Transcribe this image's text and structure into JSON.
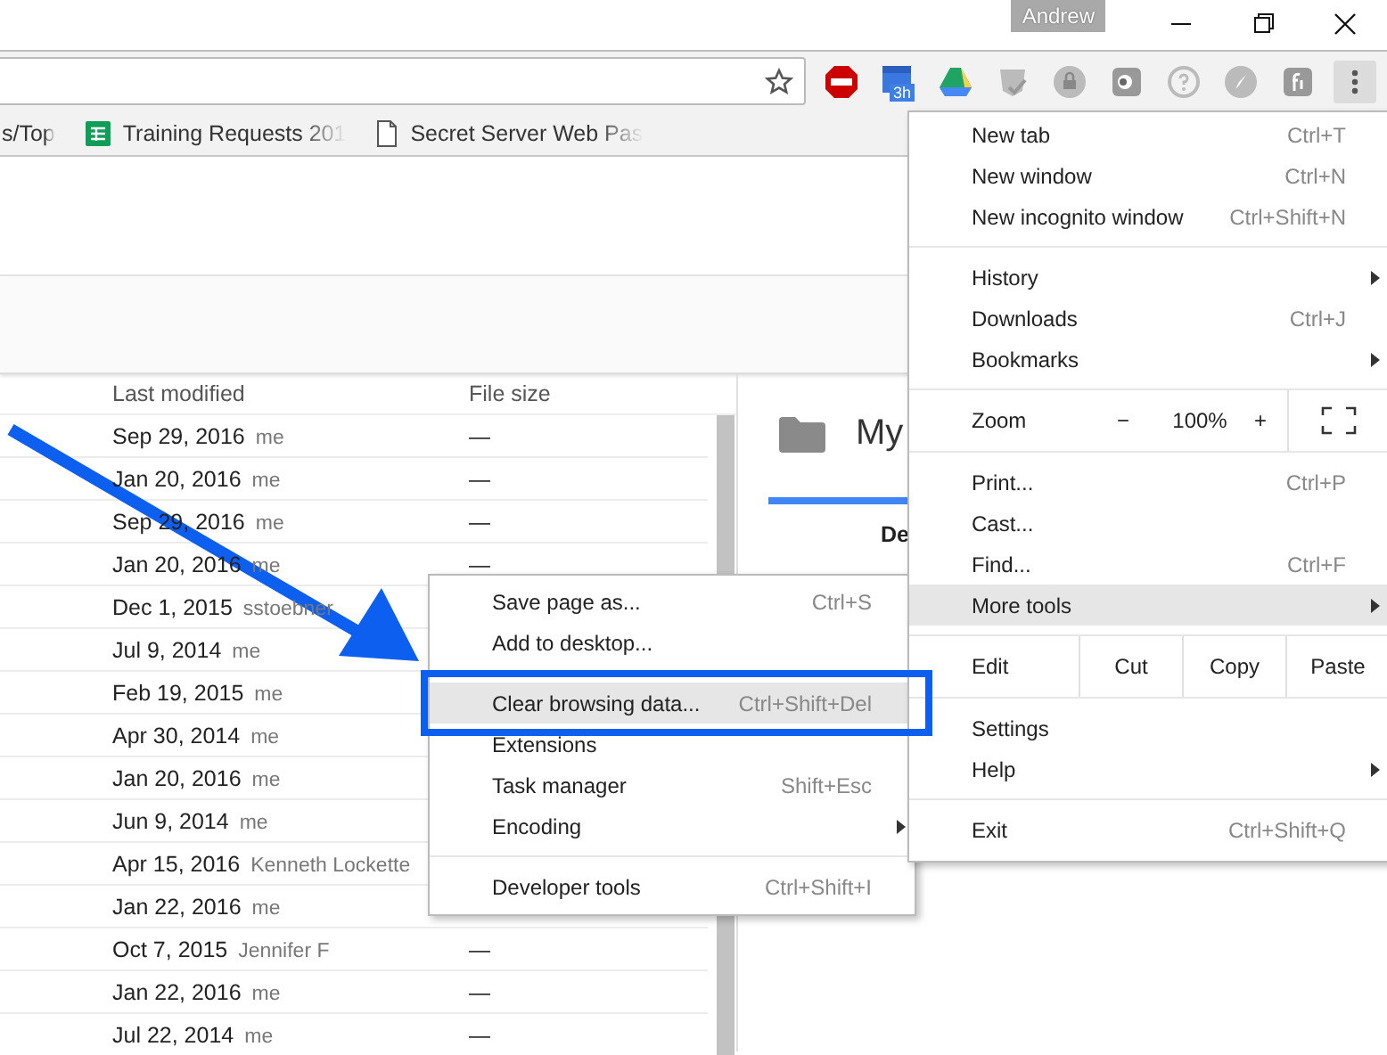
{
  "window": {
    "user": "Andrew"
  },
  "toolbar": {
    "extension_badge": "3h"
  },
  "bookmarks": [
    {
      "label": "s/Top",
      "kind": "none"
    },
    {
      "label": "Training Requests 201",
      "kind": "sheet"
    },
    {
      "label": "Secret Server Web Pas",
      "kind": "page"
    }
  ],
  "file_list": {
    "columns": [
      "Last modified",
      "File size"
    ],
    "rows": [
      {
        "modified": "Sep 29, 2016",
        "owner": "me",
        "file_size": "—"
      },
      {
        "modified": "Jan 20, 2016",
        "owner": "me",
        "file_size": "—"
      },
      {
        "modified": "Sep 29, 2016",
        "owner": "me",
        "file_size": "—"
      },
      {
        "modified": "Jan 20, 2016",
        "owner": "me",
        "file_size": "—"
      },
      {
        "modified": "Dec 1, 2015",
        "owner": "sstoebner"
      },
      {
        "modified": "Jul 9, 2014",
        "owner": "me"
      },
      {
        "modified": "Feb 19, 2015",
        "owner": "me"
      },
      {
        "modified": "Apr 30, 2014",
        "owner": "me"
      },
      {
        "modified": "Jan 20, 2016",
        "owner": "me"
      },
      {
        "modified": "Jun 9, 2014",
        "owner": "me"
      },
      {
        "modified": "Apr 15, 2016",
        "owner": "Kenneth Lockette"
      },
      {
        "modified": "Jan 22, 2016",
        "owner": "me"
      },
      {
        "modified": "Oct 7, 2015",
        "owner": "Jennifer F",
        "file_size": "—"
      },
      {
        "modified": "Jan 22, 2016",
        "owner": "me",
        "file_size": "—"
      },
      {
        "modified": "Jul 22, 2014",
        "owner": "me",
        "file_size": "—"
      }
    ]
  },
  "details_panel": {
    "title": "My",
    "tab": "De"
  },
  "chrome_menu": {
    "items": [
      {
        "kind": "item",
        "label": "New tab",
        "shortcut": "Ctrl+T",
        "selected": false,
        "has_submenu": false
      },
      {
        "kind": "item",
        "label": "New window",
        "shortcut": "Ctrl+N",
        "selected": false,
        "has_submenu": false
      },
      {
        "kind": "item",
        "label": "New incognito window",
        "shortcut": "Ctrl+Shift+N",
        "selected": false,
        "has_submenu": false
      },
      {
        "kind": "separator"
      },
      {
        "kind": "item",
        "label": "History",
        "selected": false,
        "has_submenu": true
      },
      {
        "kind": "item",
        "label": "Downloads",
        "shortcut": "Ctrl+J",
        "selected": false,
        "has_submenu": false
      },
      {
        "kind": "item",
        "label": "Bookmarks",
        "selected": false,
        "has_submenu": true
      },
      {
        "kind": "separator"
      },
      {
        "kind": "zoom",
        "label": "Zoom",
        "minus": "−",
        "value": "100%",
        "plus": "+"
      },
      {
        "kind": "separator"
      },
      {
        "kind": "item",
        "label": "Print...",
        "shortcut": "Ctrl+P",
        "selected": false,
        "has_submenu": false
      },
      {
        "kind": "item",
        "label": "Cast...",
        "selected": false,
        "has_submenu": false
      },
      {
        "kind": "item",
        "label": "Find...",
        "shortcut": "Ctrl+F",
        "selected": false,
        "has_submenu": false
      },
      {
        "kind": "item",
        "label": "More tools",
        "selected": true,
        "has_submenu": true
      },
      {
        "kind": "separator"
      },
      {
        "kind": "edit",
        "label": "Edit",
        "buttons": [
          "Cut",
          "Copy",
          "Paste"
        ]
      },
      {
        "kind": "separator"
      },
      {
        "kind": "item",
        "label": "Settings",
        "selected": false,
        "has_submenu": false
      },
      {
        "kind": "item",
        "label": "Help",
        "selected": false,
        "has_submenu": true
      },
      {
        "kind": "separator"
      },
      {
        "kind": "item",
        "label": "Exit",
        "shortcut": "Ctrl+Shift+Q",
        "selected": false,
        "has_submenu": false
      }
    ]
  },
  "more_tools_menu": {
    "items": [
      {
        "kind": "item",
        "label": "Save page as...",
        "shortcut": "Ctrl+S",
        "selected": false,
        "has_submenu": false
      },
      {
        "kind": "item",
        "label": "Add to desktop...",
        "selected": false,
        "has_submenu": false
      },
      {
        "kind": "separator"
      },
      {
        "kind": "item",
        "label": "Clear browsing data...",
        "shortcut": "Ctrl+Shift+Del",
        "selected": true,
        "has_submenu": false
      },
      {
        "kind": "item",
        "label": "Extensions",
        "selected": false,
        "has_submenu": false
      },
      {
        "kind": "item",
        "label": "Task manager",
        "shortcut": "Shift+Esc",
        "selected": false,
        "has_submenu": false
      },
      {
        "kind": "item",
        "label": "Encoding",
        "selected": false,
        "has_submenu": true
      },
      {
        "kind": "separator"
      },
      {
        "kind": "item",
        "label": "Developer tools",
        "shortcut": "Ctrl+Shift+I",
        "selected": false,
        "has_submenu": false
      }
    ]
  }
}
